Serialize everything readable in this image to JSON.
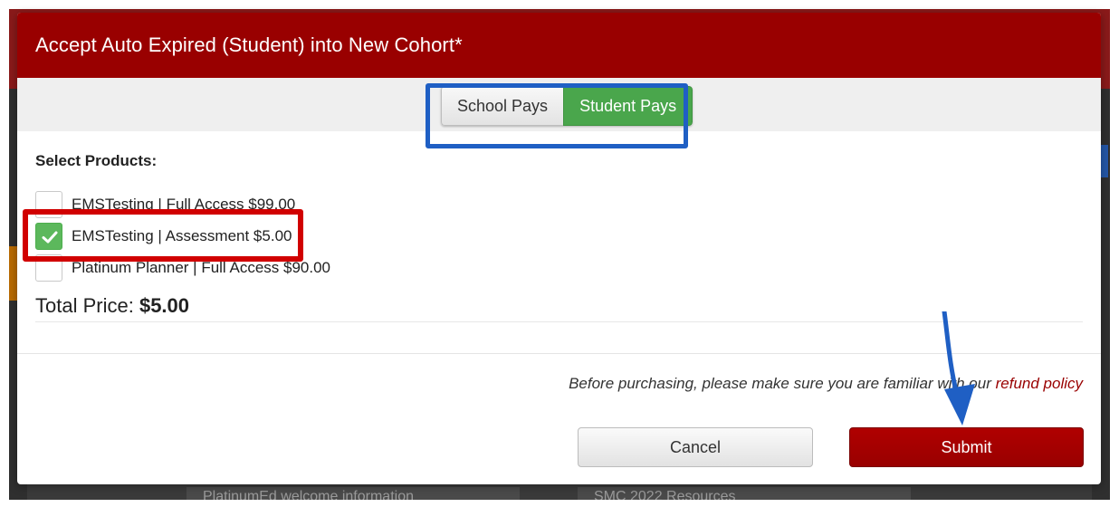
{
  "background": {
    "card_left": "PlatinumEd welcome information",
    "card_right": "SMC 2022 Resources"
  },
  "modal": {
    "title": "Accept Auto Expired (Student) into New Cohort*",
    "payment_toggle": {
      "options": [
        "School Pays",
        "Student Pays"
      ],
      "selected": "Student Pays"
    },
    "products_label": "Select Products:",
    "products": [
      {
        "label": "EMSTesting | Full Access $99.00",
        "checked": false
      },
      {
        "label": "EMSTesting | Assessment $5.00",
        "checked": true
      },
      {
        "label": "Platinum Planner | Full Access $90.00",
        "checked": false
      }
    ],
    "total_label": "Total Price:",
    "total_value": "$5.00",
    "policy_text": "Before purchasing, please make sure you are familiar with our",
    "policy_link": "refund policy",
    "buttons": {
      "cancel": "Cancel",
      "submit": "Submit"
    }
  },
  "colors": {
    "header": "#990000",
    "student_pays_active": "#4aa64c",
    "checkbox_checked": "#5cb85c",
    "highlight_toggle": "#1f5fc4",
    "highlight_product": "#d10000",
    "arrow": "#1f5fc4"
  }
}
